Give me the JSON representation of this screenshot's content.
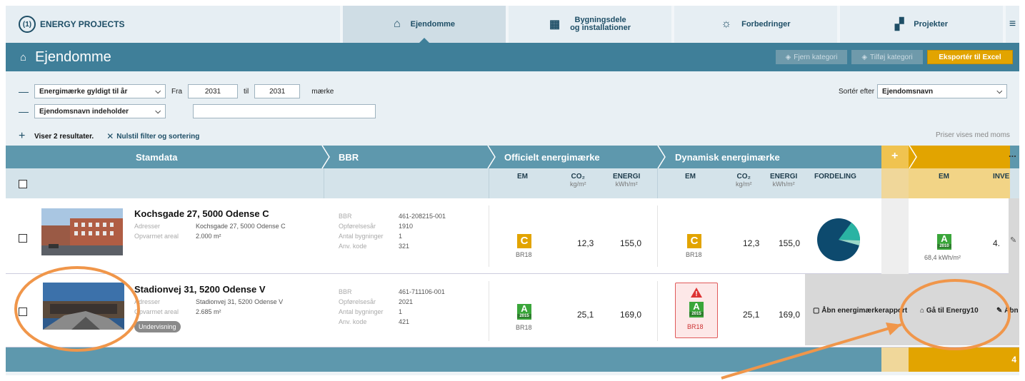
{
  "logo": {
    "text": "ENERGY PROJECTS",
    "mark": "(1)"
  },
  "nav": [
    {
      "label": "Ejendomme",
      "icon": "⌂"
    },
    {
      "label1": "Bygningsdele",
      "label2": "og installationer",
      "icon": "▦"
    },
    {
      "label": "Forbedringer",
      "icon": "☼"
    },
    {
      "label": "Projekter",
      "icon": "▞"
    }
  ],
  "menu_icon": "≡",
  "header": {
    "title": "Ejendomme",
    "home_icon": "⌂",
    "btn_remove": "Fjern kategori",
    "btn_add": "Tilføj kategori",
    "btn_export": "Eksportér til Excel"
  },
  "filters": {
    "minus": "—",
    "f1_select": "Energimærke gyldigt til år",
    "fra": "Fra",
    "from_value": "2031",
    "til": "til",
    "to_value": "2031",
    "maerke": "mærke",
    "f2_select": "Ejendomsnavn indeholder",
    "f2_value": "",
    "sort_label": "Sortér efter",
    "sort_value": "Ejendomsnavn",
    "plus": "+",
    "results": "Viser 2 resultater.",
    "reset_icon": "✕",
    "reset": "Nulstil filter og sortering",
    "prices": "Priser vises med moms",
    "chevron": "⌵"
  },
  "columns": {
    "stamdata": "Stamdata",
    "bbr": "BBR",
    "officielt": "Officielt energimærke",
    "dynamisk": "Dynamisk energimærke",
    "plus": "+",
    "more": "...",
    "em": "EM",
    "co2": "CO₂",
    "co2_unit": "kg/m²",
    "energi": "ENERGI",
    "energi_unit": "kWh/m²",
    "fordeling": "FORDELING",
    "inve": "INVE"
  },
  "rows": [
    {
      "title": "Kochsgade 27, 5000 Odense C",
      "adr_label": "Adresser",
      "adr": "Kochsgade 27, 5000 Odense C",
      "area_label": "Opvarmet areal",
      "area": "2.000 m²",
      "bbr_label": "BBR",
      "bbr": "461-208215-001",
      "year_label": "Opførelsesår",
      "year": "1910",
      "bld_label": "Antal bygninger",
      "bld": "1",
      "code_label": "Anv. kode",
      "code": "321",
      "em": "C",
      "em_std": "BR18",
      "co2": "12,3",
      "energi": "155,0",
      "dem": "C",
      "dem_std": "BR18",
      "dco2": "12,3",
      "denergi": "155,0",
      "inv_em": "A",
      "inv_year": "2010",
      "inv_kwh": "68,4 kWh/m²",
      "inv_val": "4."
    },
    {
      "title": "Stadionvej 31, 5200 Odense V",
      "adr_label": "Adresser",
      "adr": "Stadionvej 31, 5200 Odense V",
      "area_label": "Opvarmet areal",
      "area": "2.685 m²",
      "tag": "Undervisning",
      "bbr_label": "BBR",
      "bbr": "461-711106-001",
      "year_label": "Opførelsesår",
      "year": "2021",
      "bld_label": "Antal bygninger",
      "bld": "1",
      "code_label": "Anv. kode",
      "code": "421",
      "em": "A",
      "em_year": "2015",
      "em_std": "BR18",
      "co2": "25,1",
      "energi": "169,0",
      "dem": "A",
      "dem_year": "2015",
      "dem_std": "BR18",
      "dco2": "25,1",
      "denergi": "169,0",
      "warn": "!",
      "open_report": "Åbn energimærkerapport",
      "goto": "Gå til Energy10",
      "open": "Åbn",
      "report_icon": "▢",
      "home_icon": "⌂",
      "edit_icon": "✎"
    }
  ],
  "footer_val": "4",
  "colors": {
    "teal": "#3f7f99",
    "gold": "#e2a400",
    "green": "#3aa63a",
    "annotation": "#f0964a"
  }
}
